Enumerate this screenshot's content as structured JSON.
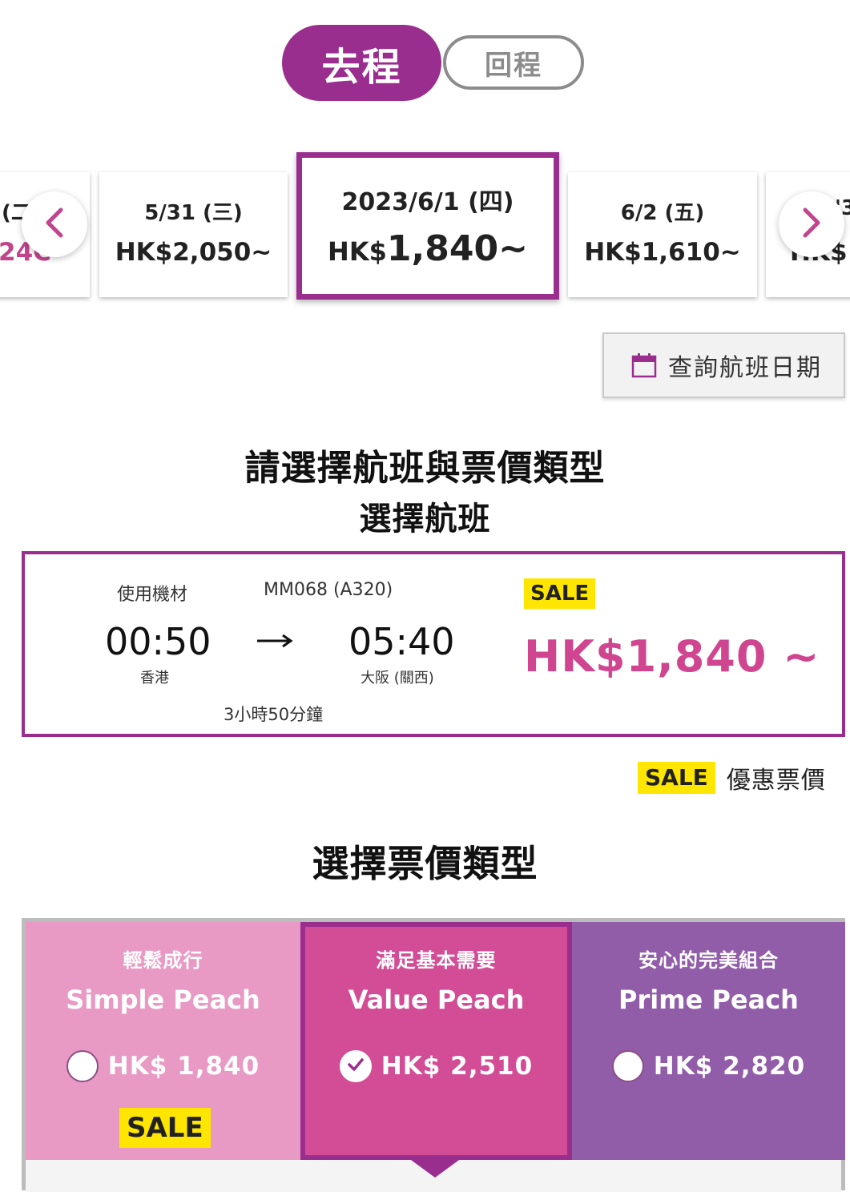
{
  "trip_toggle": {
    "outbound_label": "去程",
    "return_label": "回程",
    "active": "outbound"
  },
  "date_carousel": {
    "cards": [
      {
        "date": "(二",
        "price": "24C"
      },
      {
        "date": "5/31 (三)",
        "price": "HK$2,050~"
      },
      {
        "date": "2023/6/1 (四)",
        "price_currency": "HK$",
        "price_amount": "1,840~",
        "selected": true
      },
      {
        "date": "6/2 (五)",
        "price": "HK$1,610~"
      },
      {
        "date": "'3",
        "price": "HK$1"
      }
    ],
    "prev_icon": "chevron-left-icon",
    "next_icon": "chevron-right-icon"
  },
  "calendar_button": {
    "label": "查詢航班日期",
    "icon": "calendar-icon"
  },
  "headings": {
    "main": "請選擇航班與票價類型",
    "flight": "選擇航班",
    "fare": "選擇票價類型"
  },
  "flight": {
    "equipment_label": "使用機材",
    "flight_number": "MM068 (A320)",
    "departure_time": "00:50",
    "departure_city": "香港",
    "arrival_time": "05:40",
    "arrival_city": "大阪 (關西)",
    "duration": "3小時50分鐘",
    "sale_badge": "SALE",
    "price": "HK$1,840 ~"
  },
  "legend": {
    "badge": "SALE",
    "label": "優惠票價"
  },
  "fares": [
    {
      "tagline": "輕鬆成行",
      "name": "Simple Peach",
      "price": "HK$ 1,840",
      "sale": "SALE",
      "selected": false
    },
    {
      "tagline": "滿足基本需要",
      "name": "Value Peach",
      "price": "HK$ 2,510",
      "selected": true
    },
    {
      "tagline": "安心的完美組合",
      "name": "Prime Peach",
      "price": "HK$ 2,820",
      "selected": false
    }
  ],
  "colors": {
    "brand_purple": "#9a2e8f",
    "price_pink": "#d0458f",
    "sale_yellow": "#ffe600",
    "simple_bg": "#e89ac4",
    "value_bg": "#d24c96",
    "prime_bg": "#915ca8"
  }
}
